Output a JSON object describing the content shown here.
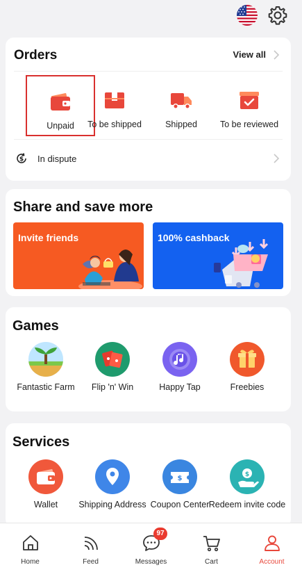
{
  "colors": {
    "accent": "#e8473b",
    "orange": "#f65a22",
    "blue": "#1361f0",
    "background": "#f2f2f4"
  },
  "header": {
    "flag_icon": "us-flag-icon",
    "settings_icon": "gear-icon"
  },
  "orders": {
    "title": "Orders",
    "view_all": "View all",
    "items": [
      {
        "label": "Unpaid",
        "icon": "wallet-icon",
        "selected": true
      },
      {
        "label": "To be shipped",
        "icon": "package-icon"
      },
      {
        "label": "Shipped",
        "icon": "truck-icon"
      },
      {
        "label": "To be reviewed",
        "icon": "review-box-icon"
      }
    ],
    "dispute": {
      "label": "In dispute",
      "icon": "dispute-dollar-icon"
    }
  },
  "share": {
    "title": "Share and save more",
    "banners": [
      {
        "label": "Invite friends"
      },
      {
        "label": "100% cashback"
      }
    ]
  },
  "games": {
    "title": "Games",
    "items": [
      {
        "label": "Fantastic Farm",
        "icon": "farm-tree-icon"
      },
      {
        "label": "Flip 'n' Win",
        "icon": "cards-icon"
      },
      {
        "label": "Happy Tap",
        "icon": "music-note-icon"
      },
      {
        "label": "Freebies",
        "icon": "gift-icon"
      }
    ]
  },
  "services": {
    "title": "Services",
    "items": [
      {
        "label": "Wallet",
        "icon": "wallet-icon"
      },
      {
        "label": "Shipping Address",
        "icon": "location-pin-icon"
      },
      {
        "label": "Coupon Center",
        "icon": "coupon-icon"
      },
      {
        "label": "Redeem invite code",
        "icon": "redeem-hand-coin-icon"
      }
    ]
  },
  "nav": {
    "items": [
      {
        "label": "Home",
        "icon": "home-icon"
      },
      {
        "label": "Feed",
        "icon": "feed-icon"
      },
      {
        "label": "Messages",
        "icon": "chat-icon",
        "badge": "97"
      },
      {
        "label": "Cart",
        "icon": "cart-icon"
      },
      {
        "label": "Account",
        "icon": "account-icon",
        "active": true
      }
    ]
  }
}
